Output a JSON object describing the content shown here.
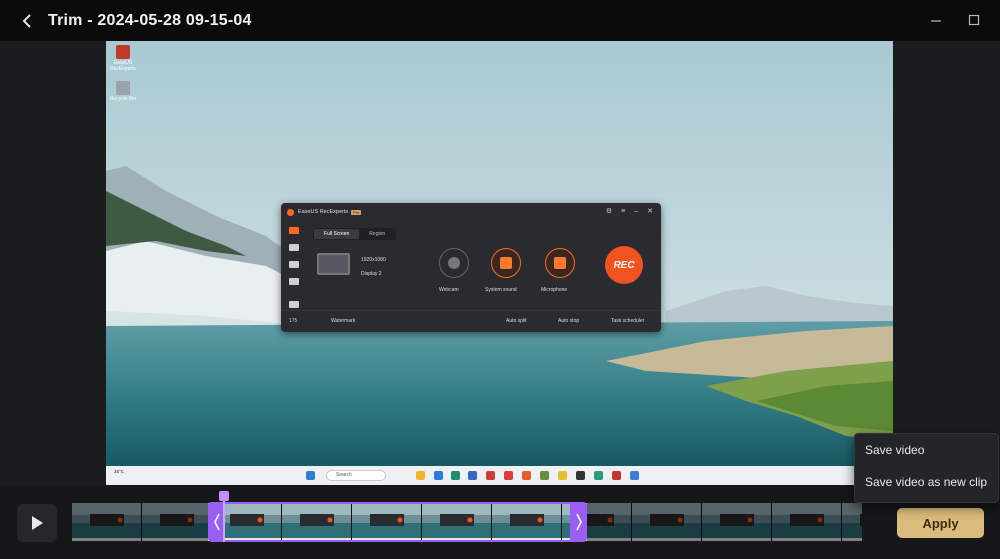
{
  "titlebar": {
    "title": "Trim - 2024-05-28 09-15-04",
    "back_icon": "chevron-left-icon",
    "minimize_icon": "minimize-icon",
    "maximize_icon": "maximize-icon"
  },
  "desktop": {
    "icons": [
      {
        "label": "EaseUS RecExperts",
        "color": "#c0392b"
      },
      {
        "label": "Recycle Bin",
        "color": "#9aa3ad"
      }
    ]
  },
  "recorder": {
    "app_name": "EaseUS RecExperts",
    "badge": "Pro",
    "tabs": [
      "Full Screen",
      "Region"
    ],
    "resolution": "1920x1080",
    "display": "Display 2",
    "sources": [
      {
        "label": "Webcam",
        "state": "off"
      },
      {
        "label": "System sound",
        "state": "on"
      },
      {
        "label": "Microphone",
        "state": "on"
      }
    ],
    "rec_label": "REC",
    "side_count": "175",
    "footer": {
      "watermark": "Watermark",
      "auto_split": "Auto split",
      "auto_stop": "Auto stop",
      "task_scheduler": "Task scheduler"
    }
  },
  "taskbar": {
    "weather_line1": "25°C",
    "weather_line2": "",
    "search_placeholder": "Search"
  },
  "context_menu": {
    "items": [
      {
        "label": "Save video"
      },
      {
        "label": "Save video as new clip"
      }
    ]
  },
  "timeline": {
    "play_icon": "play-icon",
    "selection_start_fraction": 0.172,
    "selection_end_fraction": 0.652,
    "playhead_fraction": 0.19,
    "accent": "#9b5ef5"
  },
  "actions": {
    "apply_label": "Apply",
    "apply_color": "#dcbc7c"
  }
}
